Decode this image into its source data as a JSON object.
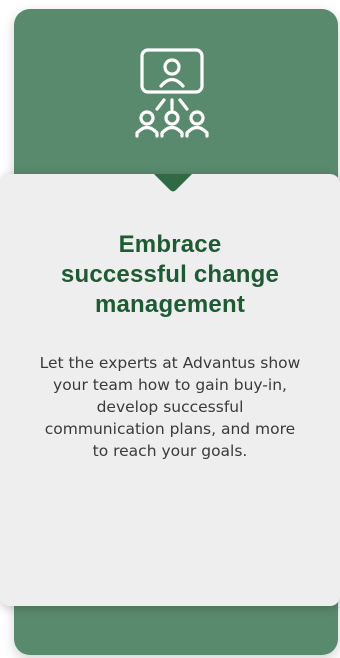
{
  "card": {
    "icon": "presentation-team-icon",
    "heading_lines": [
      "Embrace",
      "successful change",
      "management"
    ],
    "body_lines": [
      "Let the experts at Advantus show",
      "your team how to gain buy-in,",
      "develop successful",
      "communication plans, and more",
      "to reach your goals."
    ]
  },
  "colors": {
    "card_green": "#5a8a6d",
    "notch_green": "#2f6a45",
    "heading_green": "#1e5a33",
    "panel_gray": "#eeeeee",
    "body_text": "#3a3a3a",
    "icon_stroke": "#ffffff"
  }
}
